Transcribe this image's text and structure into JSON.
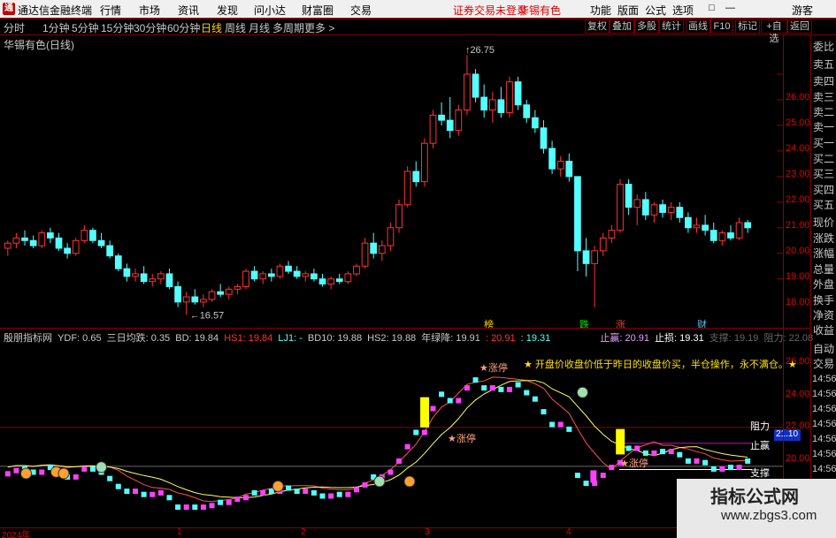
{
  "app": {
    "title": "通达信金融终端",
    "logo_char": "通"
  },
  "menus": [
    "行情",
    "市场",
    "资讯",
    "发现",
    "问小达",
    "财富圈",
    "交易"
  ],
  "warning": "证券交易未登录",
  "stock_name": "华锡有色",
  "right_menus": [
    "功能",
    "版面",
    "公式",
    "选项"
  ],
  "user": "游客",
  "window_buttons": [
    "□",
    "—",
    "▭",
    "✕"
  ],
  "periods": [
    {
      "label": "分时",
      "active": false
    },
    {
      "label": "1分钟",
      "active": false
    },
    {
      "label": "5分钟",
      "active": false
    },
    {
      "label": "15分钟",
      "active": false
    },
    {
      "label": "30分钟",
      "active": false
    },
    {
      "label": "60分钟",
      "active": false
    },
    {
      "label": "日线",
      "active": true
    },
    {
      "label": "周线",
      "active": false
    },
    {
      "label": "月线",
      "active": false
    },
    {
      "label": "多周期",
      "active": false
    },
    {
      "label": "更多 >",
      "active": false
    }
  ],
  "tool_buttons": [
    "复权",
    "叠加",
    "多股",
    "统计",
    "画线",
    "F10",
    "标记",
    "+自选",
    "返回"
  ],
  "main_title": "华锡有色(日线)",
  "price_axis": [
    "26.00",
    "25.00",
    "24.00",
    "23.00",
    "22.00",
    "21.00",
    "20.00",
    "19.00",
    "18.00"
  ],
  "high_label": "26.75",
  "low_label": "16.57",
  "event_labels": [
    "榜",
    "跌",
    "涨",
    "财"
  ],
  "indicator_header": {
    "name": "殷朋指标网",
    "ydf": "YDF: 0.65",
    "sanri": "三日均跌: 0.35",
    "bd": "BD: 19.84",
    "hs1": "HS1: 19.84",
    "lj1": "LJ1: -",
    "bd10": "BD10: 19.88",
    "hs2": "HS2: 19.88",
    "nianlv": "年绿降: 19.91",
    "v1": ": 20.91",
    "v2": ": 19.31",
    "zhiying": "止赢: 20.91",
    "zhisun": "止损: 19.31",
    "zhicheng": "支撑: 19.19",
    "zuli": "阻力: 22.08"
  },
  "ind_axis": [
    "26.00",
    "24.00",
    "22.00",
    "20.00"
  ],
  "ind_labels": {
    "zuli": "阻力",
    "zhiying": "止赢",
    "zhicheng": "支撑",
    "price_box": "21.10"
  },
  "ind_notes": {
    "zhangting": "★涨停",
    "tip": "★ 开盘价收盘价低于昨日的收盘价买，半仓操作，永不满仓。★",
    "zhangting2": "★涨停",
    "zhangting3": "★涨停"
  },
  "right_panel": [
    "委比",
    "卖五",
    "卖四",
    "卖三",
    "卖二",
    "卖一",
    "买一",
    "买二",
    "买三",
    "买四",
    "买五",
    "现价",
    "涨跌",
    "涨幅",
    "总量",
    "外盘",
    "换手",
    "净资",
    "收益",
    "自动",
    "交易"
  ],
  "right_times": [
    "14:56",
    "14:56",
    "14:56",
    "14:56",
    "14:56",
    "14:56",
    "14:56"
  ],
  "dates": [
    "2024年",
    "1",
    "2",
    "3",
    "4"
  ],
  "watermark": {
    "line1": "指标公式网",
    "line2": "www.zbgs3.com"
  },
  "colors": {
    "up": "#ff3232",
    "down": "#54ffff",
    "accent": "#ffd400",
    "grid": "#8a0000"
  },
  "chart_data": {
    "type": "candlestick",
    "title": "华锡有色(日线)",
    "ylim": [
      16.3,
      27.0
    ],
    "candles": [
      [
        19.2,
        19.5,
        18.9,
        19.4
      ],
      [
        19.4,
        19.8,
        19.2,
        19.6
      ],
      [
        19.6,
        19.9,
        19.3,
        19.5
      ],
      [
        19.5,
        19.7,
        19.2,
        19.3
      ],
      [
        19.3,
        19.9,
        19.2,
        19.8
      ],
      [
        19.8,
        20.0,
        19.4,
        19.6
      ],
      [
        19.6,
        19.8,
        19.1,
        19.2
      ],
      [
        19.2,
        19.4,
        18.8,
        19.0
      ],
      [
        19.0,
        19.6,
        18.9,
        19.5
      ],
      [
        19.5,
        20.1,
        19.4,
        19.9
      ],
      [
        19.9,
        20.0,
        19.4,
        19.5
      ],
      [
        19.5,
        19.8,
        19.2,
        19.3
      ],
      [
        19.3,
        19.5,
        18.8,
        18.9
      ],
      [
        18.9,
        19.0,
        18.3,
        18.4
      ],
      [
        18.4,
        18.6,
        17.9,
        18.1
      ],
      [
        18.1,
        18.4,
        17.9,
        18.2
      ],
      [
        18.2,
        18.5,
        17.8,
        17.9
      ],
      [
        17.9,
        18.2,
        17.7,
        18.0
      ],
      [
        18.0,
        18.3,
        17.8,
        18.2
      ],
      [
        18.2,
        18.4,
        17.6,
        17.7
      ],
      [
        17.7,
        17.9,
        16.9,
        17.1
      ],
      [
        17.1,
        17.5,
        16.6,
        17.3
      ],
      [
        17.3,
        17.6,
        17.0,
        17.1
      ],
      [
        17.1,
        17.4,
        16.9,
        17.2
      ],
      [
        17.2,
        17.6,
        17.1,
        17.5
      ],
      [
        17.5,
        17.8,
        17.3,
        17.4
      ],
      [
        17.4,
        17.7,
        17.2,
        17.6
      ],
      [
        17.6,
        17.8,
        17.4,
        17.7
      ],
      [
        17.7,
        18.4,
        17.6,
        18.3
      ],
      [
        18.3,
        18.5,
        17.9,
        18.0
      ],
      [
        18.0,
        18.3,
        17.8,
        18.2
      ],
      [
        18.2,
        18.4,
        17.9,
        18.1
      ],
      [
        18.1,
        18.6,
        18.0,
        18.5
      ],
      [
        18.5,
        18.7,
        18.2,
        18.3
      ],
      [
        18.3,
        18.5,
        18.0,
        18.1
      ],
      [
        18.1,
        18.3,
        17.9,
        18.2
      ],
      [
        18.2,
        18.4,
        17.9,
        18.0
      ],
      [
        18.0,
        18.2,
        17.7,
        17.8
      ],
      [
        17.8,
        18.1,
        17.6,
        18.0
      ],
      [
        18.0,
        18.2,
        17.8,
        17.9
      ],
      [
        17.9,
        18.3,
        17.8,
        18.2
      ],
      [
        18.2,
        18.6,
        18.1,
        18.5
      ],
      [
        18.5,
        19.6,
        18.4,
        19.4
      ],
      [
        19.4,
        19.8,
        18.8,
        19.0
      ],
      [
        19.0,
        19.5,
        18.7,
        19.3
      ],
      [
        19.3,
        20.2,
        19.1,
        20.0
      ],
      [
        20.0,
        21.1,
        19.8,
        20.9
      ],
      [
        20.9,
        22.4,
        20.8,
        22.2
      ],
      [
        22.2,
        22.6,
        21.6,
        21.8
      ],
      [
        21.8,
        23.5,
        21.6,
        23.3
      ],
      [
        23.3,
        24.6,
        23.1,
        24.4
      ],
      [
        24.4,
        24.9,
        24.0,
        24.2
      ],
      [
        24.2,
        25.1,
        23.5,
        23.8
      ],
      [
        23.8,
        24.8,
        23.6,
        24.6
      ],
      [
        24.6,
        26.75,
        24.4,
        26.0
      ],
      [
        26.0,
        26.2,
        24.9,
        25.1
      ],
      [
        25.1,
        25.6,
        24.3,
        24.6
      ],
      [
        24.6,
        25.3,
        24.1,
        25.0
      ],
      [
        25.0,
        25.5,
        24.3,
        24.5
      ],
      [
        24.5,
        25.9,
        24.3,
        25.7
      ],
      [
        25.7,
        25.9,
        24.6,
        24.8
      ],
      [
        24.8,
        25.0,
        24.1,
        24.3
      ],
      [
        24.3,
        24.6,
        23.7,
        23.9
      ],
      [
        23.9,
        24.2,
        22.9,
        23.1
      ],
      [
        23.1,
        23.4,
        22.1,
        22.3
      ],
      [
        22.3,
        22.8,
        22.0,
        22.6
      ],
      [
        22.6,
        22.9,
        21.8,
        22.0
      ],
      [
        22.0,
        20.3,
        18.3,
        19.1
      ],
      [
        19.1,
        19.6,
        18.1,
        18.6
      ],
      [
        18.6,
        19.3,
        16.9,
        19.1
      ],
      [
        19.1,
        19.8,
        18.9,
        19.6
      ],
      [
        19.6,
        20.1,
        19.4,
        19.9
      ],
      [
        19.9,
        21.9,
        19.8,
        21.7
      ],
      [
        21.7,
        21.9,
        20.5,
        20.8
      ],
      [
        20.8,
        21.3,
        20.1,
        21.1
      ],
      [
        21.1,
        21.4,
        20.3,
        20.5
      ],
      [
        20.5,
        21.0,
        20.2,
        20.9
      ],
      [
        20.9,
        21.1,
        20.4,
        20.6
      ],
      [
        20.6,
        21.0,
        20.3,
        20.8
      ],
      [
        20.8,
        21.0,
        20.2,
        20.4
      ],
      [
        20.4,
        20.6,
        19.8,
        20.0
      ],
      [
        20.0,
        20.4,
        19.8,
        20.1
      ],
      [
        20.1,
        20.5,
        19.7,
        19.9
      ],
      [
        19.9,
        20.2,
        19.4,
        19.5
      ],
      [
        19.5,
        19.9,
        19.3,
        19.8
      ],
      [
        19.8,
        20.1,
        19.5,
        19.6
      ],
      [
        19.6,
        20.4,
        19.5,
        20.2
      ],
      [
        20.2,
        20.3,
        19.8,
        20.0
      ]
    ]
  }
}
